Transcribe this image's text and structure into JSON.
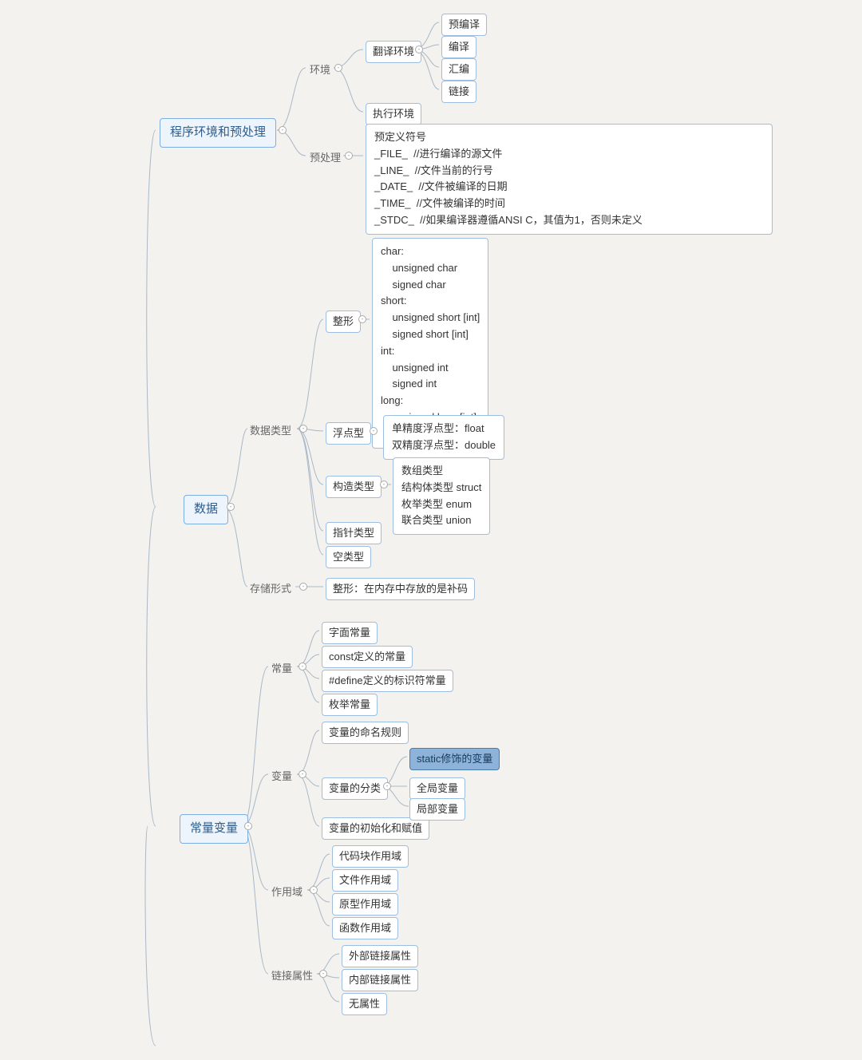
{
  "roots": {
    "r1": "程序环境和预处理",
    "r2": "数据",
    "r3": "常量变量"
  },
  "r1": {
    "env": "环境",
    "preproc": "预处理",
    "trans_env": "翻译环境",
    "exec_env": "执行环境",
    "trans_items": {
      "a": "预编译",
      "b": "编译",
      "c": "汇编",
      "d": "链接"
    },
    "preproc_detail": "预定义符号\n_FILE_  //进行编译的源文件\n_LINE_  //文件当前的行号\n_DATE_  //文件被编译的日期\n_TIME_  //文件被编译的时间\n_STDC_  //如果编译器遵循ANSI C，其值为1，否则未定义"
  },
  "r2": {
    "datatype": "数据类型",
    "storage": "存储形式",
    "int": "整形",
    "float": "浮点型",
    "struct": "构造类型",
    "ptr": "指针类型",
    "void": "空类型",
    "int_detail": "char:\n    unsigned char\n    signed char\nshort:\n    unsigned short [int]\n    signed short [int]\nint:\n    unsigned int\n    signed int\nlong:\n    unsigned long [int]\n    signed long [int]",
    "float_detail": "单精度浮点型：float\n双精度浮点型：double",
    "struct_detail": "数组类型\n结构体类型 struct\n枚举类型 enum\n联合类型 union",
    "storage_detail": "整形：在内存中存放的是补码"
  },
  "r3": {
    "const": "常量",
    "var": "变量",
    "scope": "作用域",
    "link": "链接属性",
    "const_items": {
      "a": "字面常量",
      "b": "const定义的常量",
      "c": "#define定义的标识符常量",
      "d": "枚举常量"
    },
    "var_items": {
      "a": "变量的命名规则",
      "b": "变量的分类",
      "c": "变量的初始化和赋值"
    },
    "var_class": {
      "static": "static修饰的变量",
      "global": "全局变量",
      "local": "局部变量"
    },
    "scope_items": {
      "a": "代码块作用域",
      "b": "文件作用域",
      "c": "原型作用域",
      "d": "函数作用域"
    },
    "link_items": {
      "a": "外部链接属性",
      "b": "内部链接属性",
      "c": "无属性"
    }
  }
}
